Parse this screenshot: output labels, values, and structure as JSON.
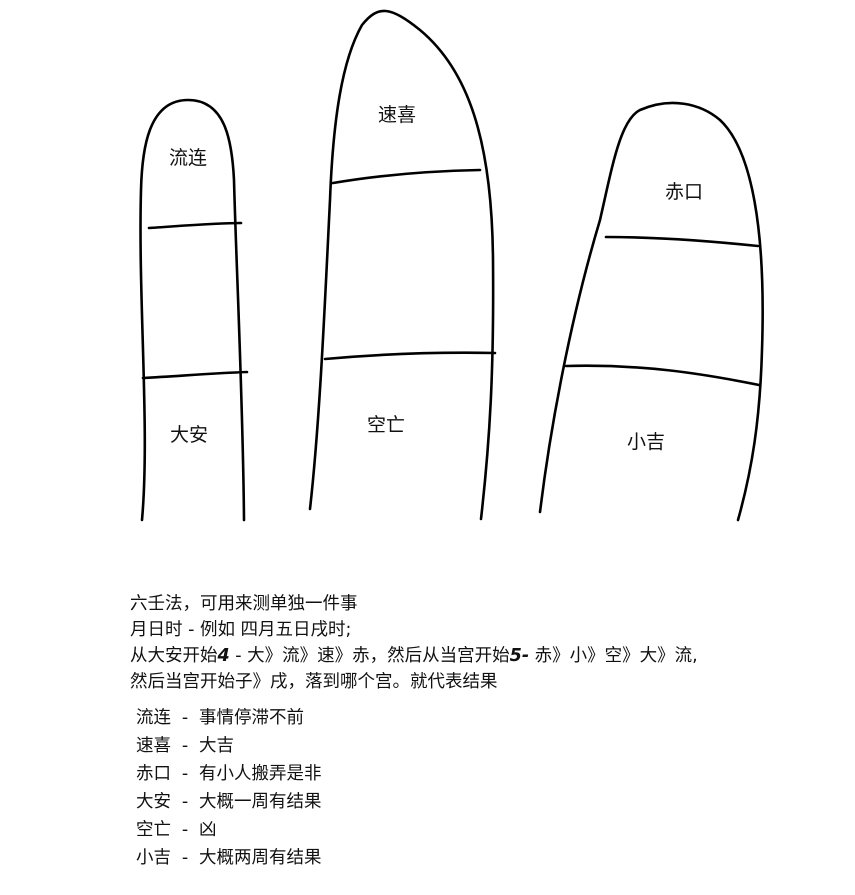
{
  "fingers": {
    "index": {
      "top": "流连",
      "bottom": "大安"
    },
    "middle": {
      "top": "速喜",
      "bottom": "空亡"
    },
    "ring": {
      "top": "赤口",
      "bottom": "小吉"
    }
  },
  "notes": {
    "line1": "六壬法，可用来测单独一件事",
    "line2": "月日时 - 例如 四月五日戌时;",
    "line3a": "从大安开始",
    "line3b": "4",
    "line3c": " - 大》流》速》赤，然后从当宫开始",
    "line3d": "5-",
    "line3e": " 赤》小》空》大》流,",
    "line4": "然后当宫开始子》戌，落到哪个宫。就代表结果"
  },
  "legend": [
    {
      "name": "流连",
      "sep": "-",
      "meaning": "事情停滞不前"
    },
    {
      "name": "速喜",
      "sep": "-",
      "meaning": "大吉"
    },
    {
      "name": "赤口",
      "sep": "-",
      "meaning": "有小人搬弄是非"
    },
    {
      "name": "大安",
      "sep": "-",
      "meaning": "大概一周有结果"
    },
    {
      "name": "空亡",
      "sep": "-",
      "meaning": "凶"
    },
    {
      "name": "小吉",
      "sep": "-",
      "meaning": "大概两周有结果"
    }
  ]
}
